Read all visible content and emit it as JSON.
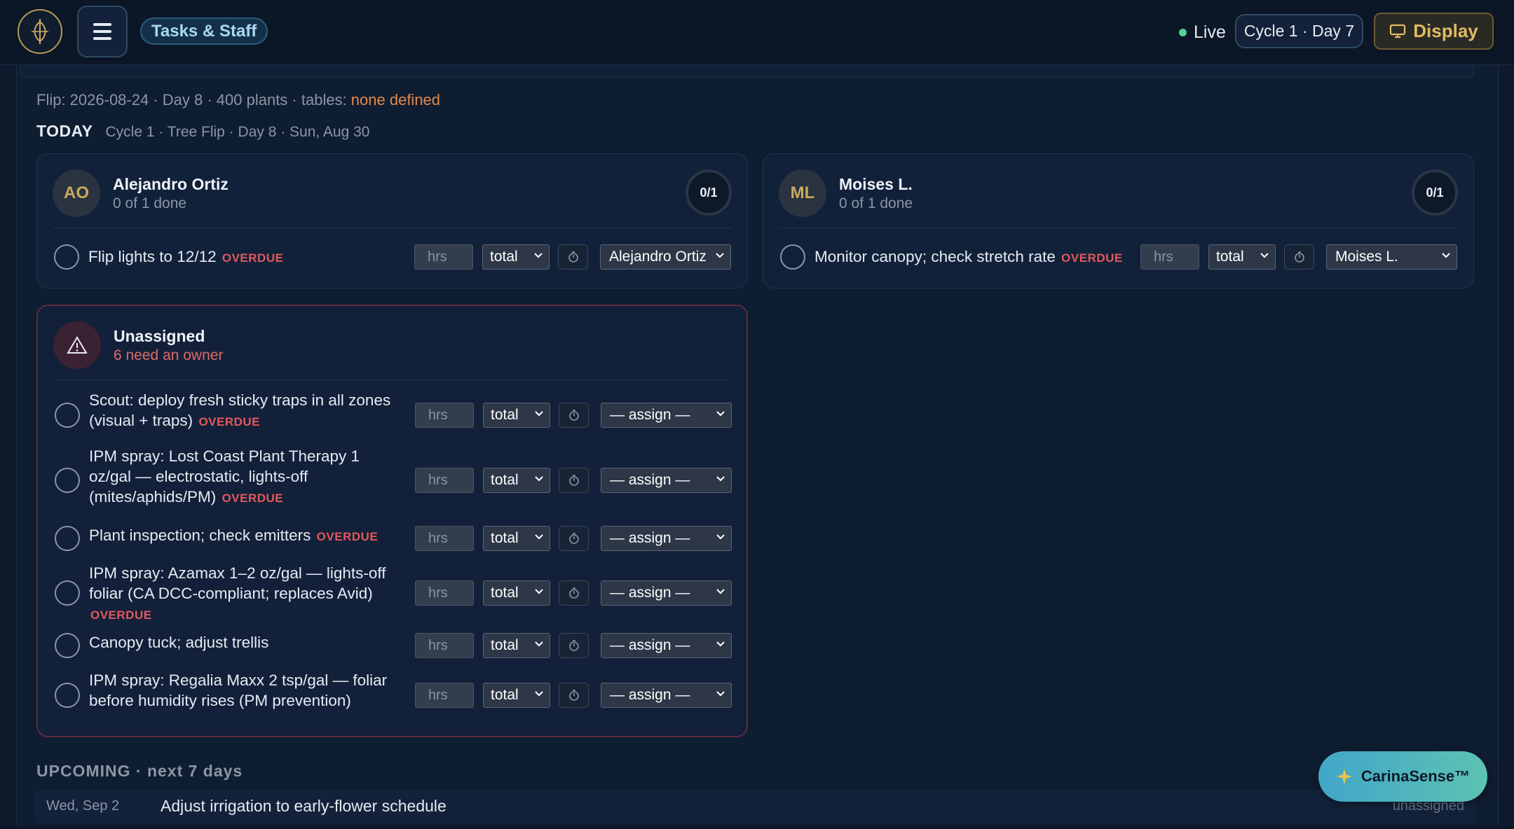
{
  "header": {
    "title": "Tasks & Staff",
    "live_label": "Live",
    "cycle_label": "Cycle 1 · Day 7",
    "display_label": "Display"
  },
  "summary": {
    "flip_prefix": "Flip: 2026-08-24 · Day 8 · 400 plants · tables: ",
    "flip_warning": "none defined",
    "today_label": "TODAY",
    "today_sub": "Cycle 1 · Tree Flip · Day 8 · Sun, Aug 30"
  },
  "common": {
    "overdue": "OVERDUE",
    "hrs_placeholder": "hrs",
    "total_label": "total",
    "assign_label": "— assign —"
  },
  "staff": [
    {
      "initials": "AO",
      "name": "Alejandro Ortiz",
      "done": "0 of 1 done",
      "progress": "0/1",
      "tasks": [
        {
          "text": "Flip lights to 12/12",
          "overdue": true,
          "assignee": "Alejandro Ortiz"
        }
      ]
    },
    {
      "initials": "ML",
      "name": "Moises L.",
      "done": "0 of 1 done",
      "progress": "0/1",
      "tasks": [
        {
          "text": "Monitor canopy; check stretch rate",
          "overdue": true,
          "assignee": "Moises L."
        }
      ]
    }
  ],
  "unassigned": {
    "title": "Unassigned",
    "sub": "6 need an owner",
    "tasks": [
      {
        "line1": "Scout: deploy fresh sticky traps in all zones",
        "line2": "(visual + traps)",
        "line3": "",
        "overdue": true
      },
      {
        "line1": "IPM spray: Lost Coast Plant Therapy 1",
        "line2": "oz/gal — electrostatic, lights-off",
        "line3": "(mites/aphids/PM)",
        "overdue": true
      },
      {
        "line1": "Plant inspection; check emitters",
        "line2": "",
        "line3": "",
        "overdue": true
      },
      {
        "line1": "IPM spray: Azamax 1–2 oz/gal — lights-off",
        "line2": "foliar (CA DCC-compliant; replaces Avid)",
        "line3": "",
        "overdue": true
      },
      {
        "line1": "Canopy tuck; adjust trellis",
        "line2": "",
        "line3": "",
        "overdue": false
      },
      {
        "line1": "IPM spray: Regalia Maxx 2 tsp/gal — foliar",
        "line2": "before humidity rises (PM prevention)",
        "line3": "",
        "overdue": false
      }
    ]
  },
  "upcoming": {
    "label": "UPCOMING · next 7 days",
    "items": [
      {
        "date": "Wed, Sep 2",
        "task": "Adjust irrigation to early-flower schedule",
        "owner": "unassigned"
      }
    ]
  },
  "assistant": {
    "label": "CarinaSense™"
  },
  "colors": {
    "accent": "#42a6c9",
    "overdue": "#e05a5a",
    "warning": "#e08a4a",
    "gold": "#e1bb63"
  }
}
